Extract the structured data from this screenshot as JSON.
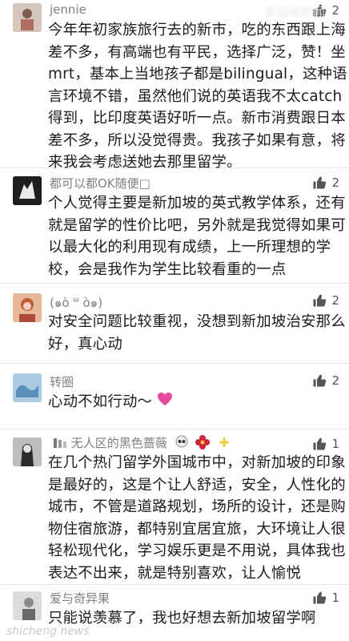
{
  "comments": [
    {
      "name": "jennie",
      "likes": "2",
      "avatar_color": "#c9b7ad",
      "lines": [
        "今年年初家族旅行去的新市，吃的东西跟上海",
        "差不多，有高端也有平民，选择广泛，赞！坐",
        "mrt，基本上当地孩子都是bilingual，这种语",
        "言环境不错，虽然他们说的英语我不太catch",
        "得到，比印度英语好听一点。新市消费跟日本",
        "差不多，所以没觉得贵。我孩子如果有意，将",
        "来我会考虑送她去那里留学。"
      ]
    },
    {
      "name": "都可以都OK随便□",
      "likes": "2",
      "avatar_color": "#2a2a2a",
      "lines": [
        "个人觉得主要是新加坡的英式教学体系，还有",
        "就是留学的性价比吧，另外就是我觉得如果可",
        "以最大化的利用现有成绩，上一所理想的学",
        "校，会是我作为学生比较看重的一点"
      ]
    },
    {
      "name": "(๑ὸ ᐜ ὸ๑)",
      "likes": "2",
      "avatar_color": "#d88e6e",
      "lines": [
        "对安全问题比较重视，没想到新加坡治安那么",
        "好，真心动"
      ]
    },
    {
      "name": "转圈",
      "likes": "2",
      "avatar_color": "#8fb8d8",
      "lines": [
        "心动不如行动～"
      ]
    },
    {
      "name": "无人区的黑色蔷薇",
      "likes": "1",
      "avatar_color": "#3a3a3a",
      "lines": [
        "在几个热门留学外国城市中，对新加坡的印象",
        "是最好的，这是个让人舒适，安全，人性化的",
        "城市，不管是道路规划，场所的设计，还是购",
        "物住宿旅游，都特别宜居宜旅，大环境让人很",
        "轻松现代化，学习娱乐更是不用说，具体我也",
        "表达不出来，就是特别喜欢，让人愉悦"
      ]
    },
    {
      "name": "爱与奇异果",
      "likes": "1",
      "avatar_color": "#cfcfcf",
      "lines": [
        "只能说羡慕了，我也好想去新加坡留学啊"
      ]
    }
  ],
  "watermark": {
    "top": "新加坡新闻",
    "bottom": "shicheng news"
  },
  "colors": {
    "name": "#7f7f7f",
    "text": "#1c1c1c",
    "like_icon": "#555555",
    "heart": "#e64a9b",
    "divider": "#e6e6e6"
  }
}
